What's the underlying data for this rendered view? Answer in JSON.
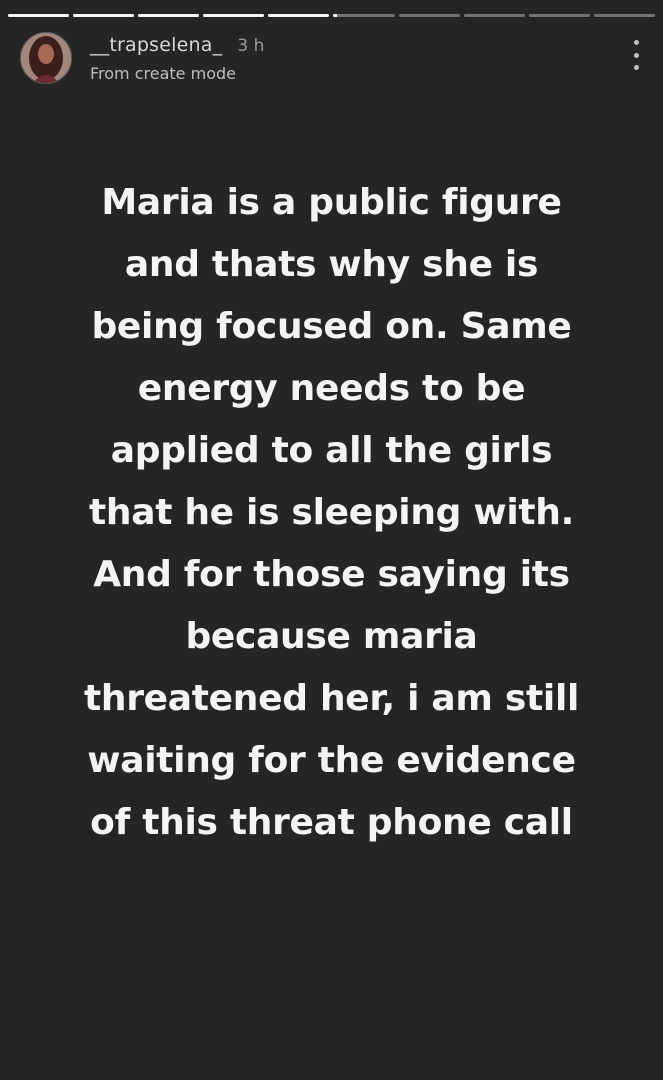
{
  "progress": {
    "segment_count": 10,
    "current_index": 5,
    "current_fill_fraction": 0.05
  },
  "header": {
    "username": "__trapselena_",
    "time_ago": "3 h",
    "subtitle": "From create mode",
    "more_icon": "more-vertical-icon"
  },
  "story": {
    "background_color": "#252525",
    "text_color": "#f4f4f4",
    "lines": [
      "Maria is a public figure",
      "and thats why she is",
      "being focused on. Same",
      "energy needs to be",
      "applied to all the girls",
      "that he is sleeping with.",
      "And for those saying its",
      "because maria",
      "threatened her, i am still",
      "waiting for the evidence",
      "of this threat phone call"
    ]
  }
}
